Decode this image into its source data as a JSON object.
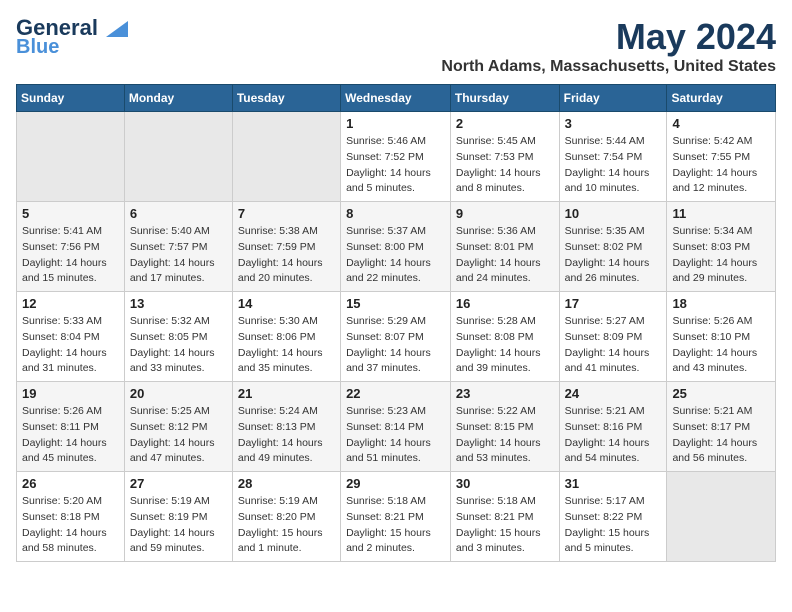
{
  "logo": {
    "line1": "General",
    "line2": "Blue"
  },
  "title": "May 2024",
  "location": "North Adams, Massachusetts, United States",
  "weekdays": [
    "Sunday",
    "Monday",
    "Tuesday",
    "Wednesday",
    "Thursday",
    "Friday",
    "Saturday"
  ],
  "weeks": [
    [
      {
        "day": "",
        "info": ""
      },
      {
        "day": "",
        "info": ""
      },
      {
        "day": "",
        "info": ""
      },
      {
        "day": "1",
        "info": "Sunrise: 5:46 AM\nSunset: 7:52 PM\nDaylight: 14 hours\nand 5 minutes."
      },
      {
        "day": "2",
        "info": "Sunrise: 5:45 AM\nSunset: 7:53 PM\nDaylight: 14 hours\nand 8 minutes."
      },
      {
        "day": "3",
        "info": "Sunrise: 5:44 AM\nSunset: 7:54 PM\nDaylight: 14 hours\nand 10 minutes."
      },
      {
        "day": "4",
        "info": "Sunrise: 5:42 AM\nSunset: 7:55 PM\nDaylight: 14 hours\nand 12 minutes."
      }
    ],
    [
      {
        "day": "5",
        "info": "Sunrise: 5:41 AM\nSunset: 7:56 PM\nDaylight: 14 hours\nand 15 minutes."
      },
      {
        "day": "6",
        "info": "Sunrise: 5:40 AM\nSunset: 7:57 PM\nDaylight: 14 hours\nand 17 minutes."
      },
      {
        "day": "7",
        "info": "Sunrise: 5:38 AM\nSunset: 7:59 PM\nDaylight: 14 hours\nand 20 minutes."
      },
      {
        "day": "8",
        "info": "Sunrise: 5:37 AM\nSunset: 8:00 PM\nDaylight: 14 hours\nand 22 minutes."
      },
      {
        "day": "9",
        "info": "Sunrise: 5:36 AM\nSunset: 8:01 PM\nDaylight: 14 hours\nand 24 minutes."
      },
      {
        "day": "10",
        "info": "Sunrise: 5:35 AM\nSunset: 8:02 PM\nDaylight: 14 hours\nand 26 minutes."
      },
      {
        "day": "11",
        "info": "Sunrise: 5:34 AM\nSunset: 8:03 PM\nDaylight: 14 hours\nand 29 minutes."
      }
    ],
    [
      {
        "day": "12",
        "info": "Sunrise: 5:33 AM\nSunset: 8:04 PM\nDaylight: 14 hours\nand 31 minutes."
      },
      {
        "day": "13",
        "info": "Sunrise: 5:32 AM\nSunset: 8:05 PM\nDaylight: 14 hours\nand 33 minutes."
      },
      {
        "day": "14",
        "info": "Sunrise: 5:30 AM\nSunset: 8:06 PM\nDaylight: 14 hours\nand 35 minutes."
      },
      {
        "day": "15",
        "info": "Sunrise: 5:29 AM\nSunset: 8:07 PM\nDaylight: 14 hours\nand 37 minutes."
      },
      {
        "day": "16",
        "info": "Sunrise: 5:28 AM\nSunset: 8:08 PM\nDaylight: 14 hours\nand 39 minutes."
      },
      {
        "day": "17",
        "info": "Sunrise: 5:27 AM\nSunset: 8:09 PM\nDaylight: 14 hours\nand 41 minutes."
      },
      {
        "day": "18",
        "info": "Sunrise: 5:26 AM\nSunset: 8:10 PM\nDaylight: 14 hours\nand 43 minutes."
      }
    ],
    [
      {
        "day": "19",
        "info": "Sunrise: 5:26 AM\nSunset: 8:11 PM\nDaylight: 14 hours\nand 45 minutes."
      },
      {
        "day": "20",
        "info": "Sunrise: 5:25 AM\nSunset: 8:12 PM\nDaylight: 14 hours\nand 47 minutes."
      },
      {
        "day": "21",
        "info": "Sunrise: 5:24 AM\nSunset: 8:13 PM\nDaylight: 14 hours\nand 49 minutes."
      },
      {
        "day": "22",
        "info": "Sunrise: 5:23 AM\nSunset: 8:14 PM\nDaylight: 14 hours\nand 51 minutes."
      },
      {
        "day": "23",
        "info": "Sunrise: 5:22 AM\nSunset: 8:15 PM\nDaylight: 14 hours\nand 53 minutes."
      },
      {
        "day": "24",
        "info": "Sunrise: 5:21 AM\nSunset: 8:16 PM\nDaylight: 14 hours\nand 54 minutes."
      },
      {
        "day": "25",
        "info": "Sunrise: 5:21 AM\nSunset: 8:17 PM\nDaylight: 14 hours\nand 56 minutes."
      }
    ],
    [
      {
        "day": "26",
        "info": "Sunrise: 5:20 AM\nSunset: 8:18 PM\nDaylight: 14 hours\nand 58 minutes."
      },
      {
        "day": "27",
        "info": "Sunrise: 5:19 AM\nSunset: 8:19 PM\nDaylight: 14 hours\nand 59 minutes."
      },
      {
        "day": "28",
        "info": "Sunrise: 5:19 AM\nSunset: 8:20 PM\nDaylight: 15 hours\nand 1 minute."
      },
      {
        "day": "29",
        "info": "Sunrise: 5:18 AM\nSunset: 8:21 PM\nDaylight: 15 hours\nand 2 minutes."
      },
      {
        "day": "30",
        "info": "Sunrise: 5:18 AM\nSunset: 8:21 PM\nDaylight: 15 hours\nand 3 minutes."
      },
      {
        "day": "31",
        "info": "Sunrise: 5:17 AM\nSunset: 8:22 PM\nDaylight: 15 hours\nand 5 minutes."
      },
      {
        "day": "",
        "info": ""
      }
    ]
  ]
}
